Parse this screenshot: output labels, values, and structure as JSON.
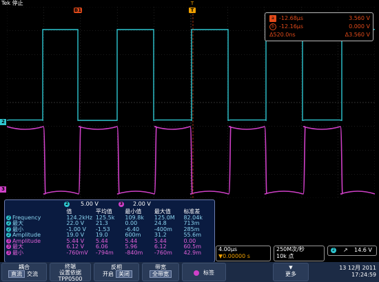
{
  "topbar": {
    "title": "Tek 停止"
  },
  "markers": {
    "b1": "B1",
    "trigger_top": "T",
    "trigger_label": "T"
  },
  "cursors": {
    "rows": [
      {
        "icon": "a",
        "time": "-12.68μs",
        "volt": "3.560 V"
      },
      {
        "icon": "b",
        "time": "-12.16μs",
        "volt": "0.000 V"
      },
      {
        "icon": "",
        "time": "Δ520.0ns",
        "volt": "Δ3.560 V"
      }
    ]
  },
  "levels": {
    "ch2": "2",
    "ch3": "3"
  },
  "scales": {
    "ch2_chip": "2",
    "ch2": "5.00 V",
    "ch3_chip": "3",
    "ch3": "2.00 V"
  },
  "measurements": {
    "headers": [
      "",
      "值",
      "平均值",
      "最小值",
      "最大值",
      "标准差"
    ],
    "rows": [
      {
        "ch": "2",
        "label": "Frequency",
        "value": "124.2kHz",
        "mean": "125.5k",
        "min": "109.8k",
        "max": "125.0M",
        "std": "82.04k"
      },
      {
        "ch": "2",
        "label": "最大",
        "value": "22.0 V",
        "mean": "21.3",
        "min": "0.00",
        "max": "24.8",
        "std": "713m"
      },
      {
        "ch": "2",
        "label": "最小",
        "value": "-1.00 V",
        "mean": "-1.53",
        "min": "-6.40",
        "max": "-400m",
        "std": "285m"
      },
      {
        "ch": "2",
        "label": "Amplitude",
        "value": "19.0 V",
        "mean": "19.0",
        "min": "600m",
        "max": "31.2",
        "std": "55.6m"
      },
      {
        "ch": "3",
        "label": "Amplitude",
        "value": "5.44 V",
        "mean": "5.44",
        "min": "5.44",
        "max": "5.44",
        "std": "0.00"
      },
      {
        "ch": "3",
        "label": "最大",
        "value": "6.12 V",
        "mean": "6.06",
        "min": "5.96",
        "max": "6.12",
        "std": "60.5m"
      },
      {
        "ch": "3",
        "label": "最小",
        "value": "-760mV",
        "mean": "-794m",
        "min": "-840m",
        "max": "-760m",
        "std": "42.9m"
      }
    ]
  },
  "timebase": {
    "per_div": "4.00μs",
    "delay": "▼0.00000 s"
  },
  "acquisition": {
    "rate": "250M次/秒",
    "points": "10k 点"
  },
  "trigger": {
    "source": "2",
    "slope": "↗",
    "level": "14.6 V"
  },
  "menu": {
    "coupling": {
      "title": "耦合",
      "opt1": "直流",
      "opt2": "交流"
    },
    "bandwidth": {
      "title": "终端",
      "line2": "设置依据",
      "line3": "TPP0500"
    },
    "invert": {
      "title": "反相",
      "opt1": "开启",
      "opt2": "关闭"
    },
    "bw_limit": {
      "title": "带宽",
      "line2": "全带宽"
    },
    "label_btn": {
      "text": "标签"
    },
    "more": {
      "text": "更多"
    }
  },
  "datetime": {
    "date": "13 12月 2011",
    "time": "17:24:59"
  },
  "colors": {
    "ch2": "#2ec8d2",
    "ch3": "#d040c8",
    "cursor": "#e24a1a",
    "trigger": "#f0a000",
    "panel": "#0a1b40"
  }
}
